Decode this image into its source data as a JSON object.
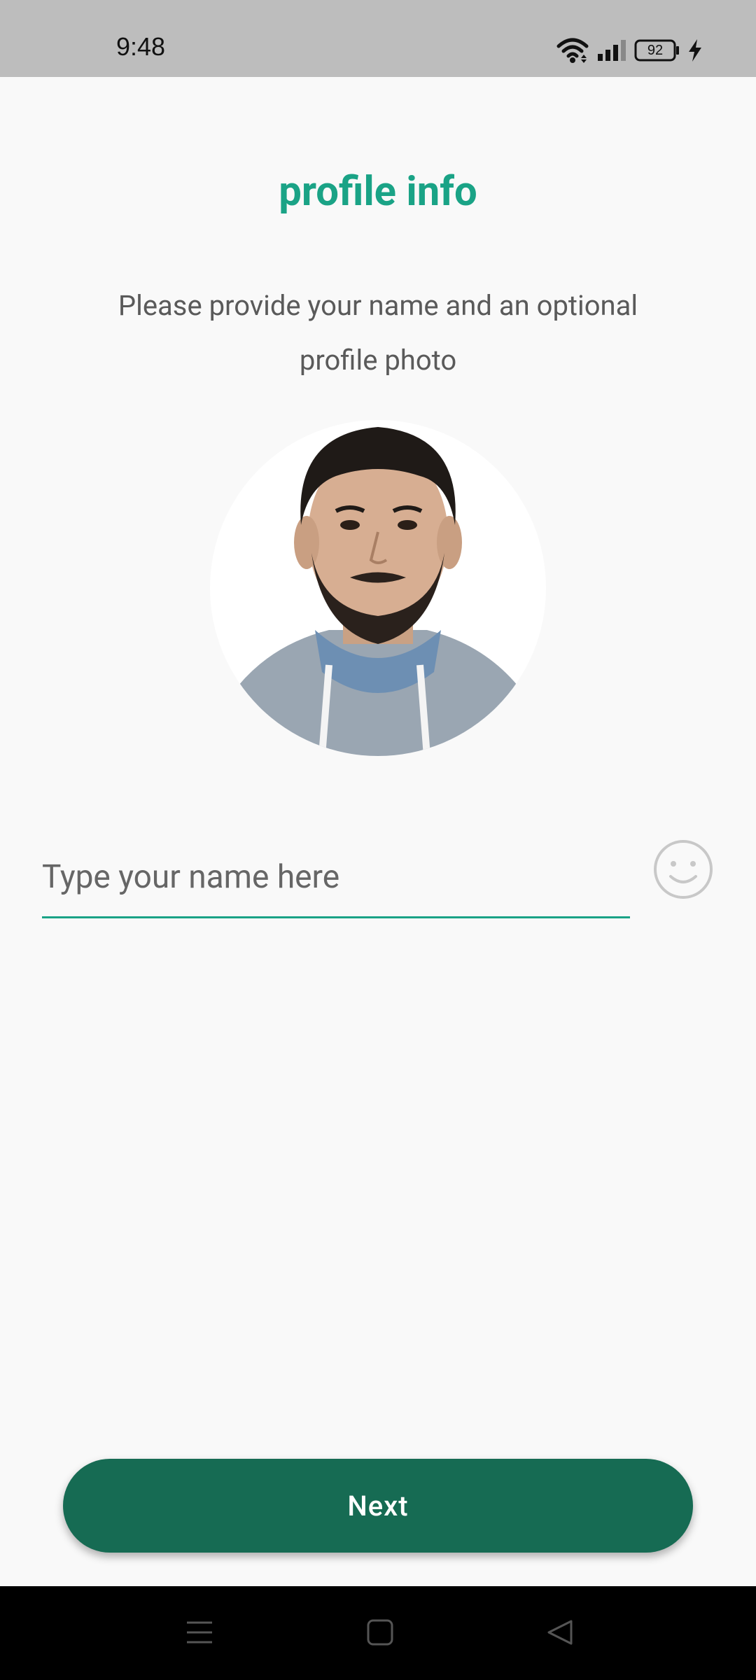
{
  "status_bar": {
    "time": "9:48",
    "battery_level": "92",
    "icons": [
      "wifi-icon",
      "signal-icon",
      "battery-icon",
      "charging-icon"
    ]
  },
  "screen": {
    "title": "profile info",
    "subtitle": "Please provide your name and an optional profile photo"
  },
  "profile_photo": {
    "icon": "profile-photo"
  },
  "name_input": {
    "placeholder": "Type your name here",
    "value": ""
  },
  "emoji_button": {
    "icon": "emoji-icon"
  },
  "next_button": {
    "label": "Next"
  },
  "nav_bar": {
    "icons": [
      "recents-icon",
      "home-icon",
      "back-icon"
    ]
  },
  "colors": {
    "accent": "#1aa386",
    "button": "#166b53",
    "background": "#f9f9f9",
    "status_bar": "#bdbdbd"
  }
}
